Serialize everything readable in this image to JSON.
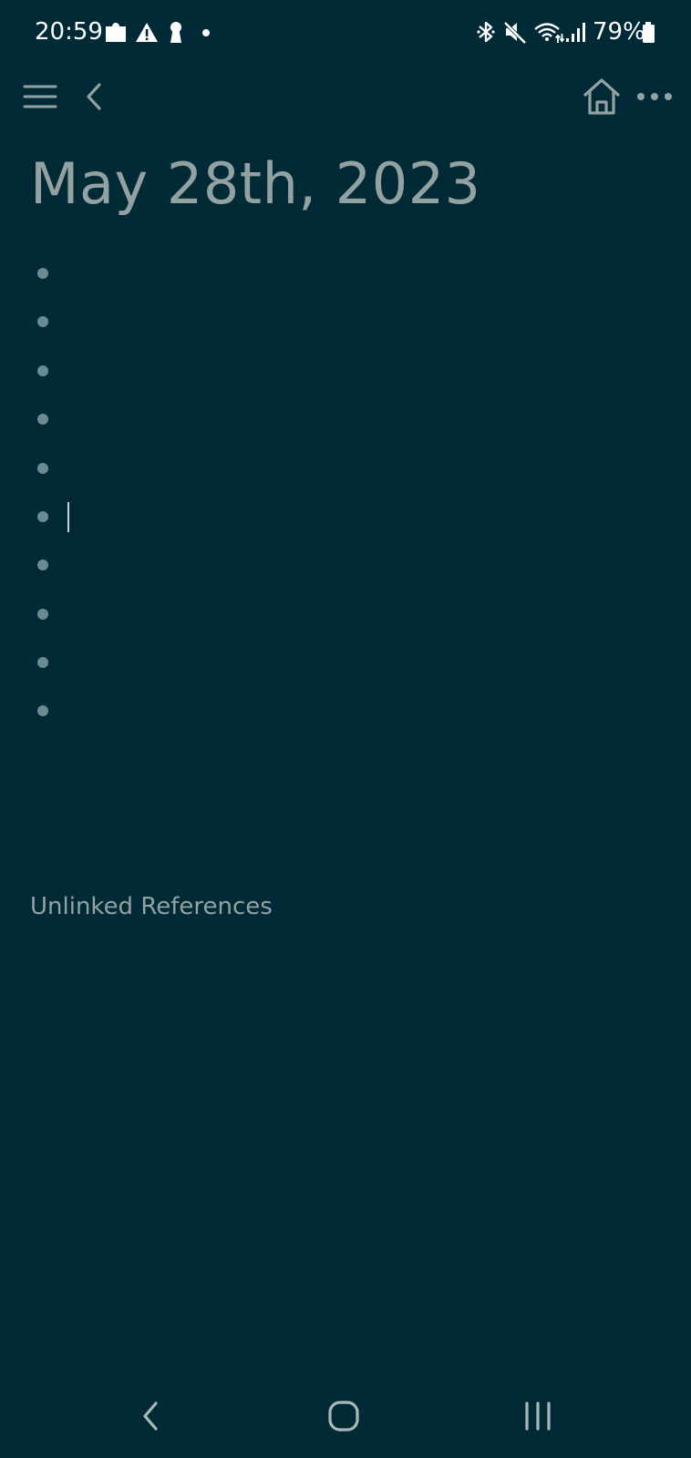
{
  "status_bar": {
    "time": "20:59",
    "battery_percent": "79%",
    "left_icons": [
      "puzzle-icon",
      "warning-icon",
      "keyhole-icon",
      "dot-icon"
    ],
    "right_icons": [
      "bluetooth-icon",
      "mute-icon",
      "wifi-icon",
      "signal-icon",
      "battery-icon"
    ]
  },
  "toolbar": {
    "left_icons": [
      "menu-icon",
      "back-icon"
    ],
    "right_icons": [
      "home-icon",
      "more-icon"
    ]
  },
  "page": {
    "title": "May 28th, 2023",
    "blocks": [
      {
        "text": ""
      },
      {
        "text": ""
      },
      {
        "text": ""
      },
      {
        "text": ""
      },
      {
        "text": ""
      },
      {
        "text": "",
        "editing": true
      },
      {
        "text": ""
      },
      {
        "text": ""
      },
      {
        "text": ""
      },
      {
        "text": ""
      }
    ],
    "unlinked_references_label": "Unlinked References"
  },
  "nav_bar": {
    "icons": [
      "nav-back-icon",
      "nav-home-icon",
      "nav-recents-icon"
    ]
  },
  "colors": {
    "background": "#002b36",
    "title": "#93a1a1",
    "bullet": "#6b8b93",
    "icon": "#93a1a1"
  }
}
